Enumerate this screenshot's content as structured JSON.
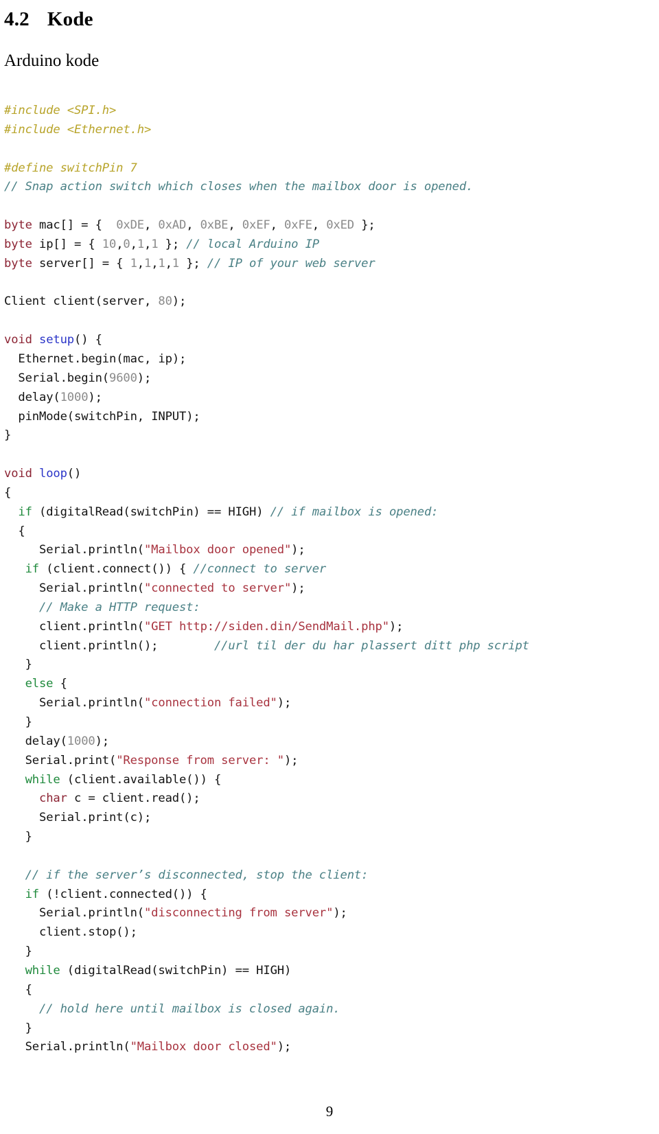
{
  "document": {
    "section_number": "4.2",
    "section_title": "Kode",
    "subtitle": "Arduino kode",
    "page_number": "9"
  },
  "colors": {
    "preprocessor": "#b8a42a",
    "comment": "#4a8085",
    "keyword": "#8c2434",
    "function": "#2b35c8",
    "control": "#1f8a3c",
    "string": "#a8333f",
    "number": "#8a8a8a",
    "plain": "#121212",
    "background": "#ffffff"
  },
  "code": {
    "language": "Arduino C++",
    "lines": [
      {
        "id": "l1",
        "text": "#include <SPI.h>"
      },
      {
        "id": "l2",
        "text": "#include <Ethernet.h>"
      },
      {
        "id": "l3",
        "text": ""
      },
      {
        "id": "l4",
        "text": "#define switchPin 7"
      },
      {
        "id": "l5",
        "text": "// Snap action switch which closes when the mailbox door is opened."
      },
      {
        "id": "l6",
        "text": ""
      },
      {
        "id": "l7",
        "text": "byte mac[] = {  0xDE, 0xAD, 0xBE, 0xEF, 0xFE, 0xED };"
      },
      {
        "id": "l8",
        "text": "byte ip[] = { 10,0,1,1 }; // local Arduino IP"
      },
      {
        "id": "l9",
        "text": "byte server[] = { 1,1,1,1 }; // IP of your web server"
      },
      {
        "id": "l10",
        "text": ""
      },
      {
        "id": "l11",
        "text": "Client client(server, 80);"
      },
      {
        "id": "l12",
        "text": ""
      },
      {
        "id": "l13",
        "text": "void setup() {"
      },
      {
        "id": "l14",
        "text": "  Ethernet.begin(mac, ip);"
      },
      {
        "id": "l15",
        "text": "  Serial.begin(9600);"
      },
      {
        "id": "l16",
        "text": "  delay(1000);"
      },
      {
        "id": "l17",
        "text": "  pinMode(switchPin, INPUT);"
      },
      {
        "id": "l18",
        "text": "}"
      },
      {
        "id": "l19",
        "text": ""
      },
      {
        "id": "l20",
        "text": "void loop()"
      },
      {
        "id": "l21",
        "text": "{"
      },
      {
        "id": "l22",
        "text": "  if (digitalRead(switchPin) == HIGH) // if mailbox is opened:"
      },
      {
        "id": "l23",
        "text": "  {"
      },
      {
        "id": "l24",
        "text": "     Serial.println(\"Mailbox door opened\");"
      },
      {
        "id": "l25",
        "text": "   if (client.connect()) { //connect to server"
      },
      {
        "id": "l26",
        "text": "     Serial.println(\"connected to server\");"
      },
      {
        "id": "l27",
        "text": "     // Make a HTTP request:"
      },
      {
        "id": "l28",
        "text": "     client.println(\"GET http://siden.din/SendMail.php\");"
      },
      {
        "id": "l29",
        "text": "     client.println();        //url til der du har plassert ditt php script"
      },
      {
        "id": "l30",
        "text": "   }"
      },
      {
        "id": "l31",
        "text": "   else {"
      },
      {
        "id": "l32",
        "text": "     Serial.println(\"connection failed\");"
      },
      {
        "id": "l33",
        "text": "   }"
      },
      {
        "id": "l34",
        "text": "   delay(1000);"
      },
      {
        "id": "l35",
        "text": "   Serial.print(\"Response from server: \");"
      },
      {
        "id": "l36",
        "text": "   while (client.available()) {"
      },
      {
        "id": "l37",
        "text": "     char c = client.read();"
      },
      {
        "id": "l38",
        "text": "     Serial.print(c);"
      },
      {
        "id": "l39",
        "text": "   }"
      },
      {
        "id": "l40",
        "text": ""
      },
      {
        "id": "l41",
        "text": "   // if the server’s disconnected, stop the client:"
      },
      {
        "id": "l42",
        "text": "   if (!client.connected()) {"
      },
      {
        "id": "l43",
        "text": "     Serial.println(\"disconnecting from server\");"
      },
      {
        "id": "l44",
        "text": "     client.stop();"
      },
      {
        "id": "l45",
        "text": "   }"
      },
      {
        "id": "l46",
        "text": "   while (digitalRead(switchPin) == HIGH)"
      },
      {
        "id": "l47",
        "text": "   {"
      },
      {
        "id": "l48",
        "text": "     // hold here until mailbox is closed again."
      },
      {
        "id": "l49",
        "text": "   }"
      },
      {
        "id": "l50",
        "text": "   Serial.println(\"Mailbox door closed\");"
      }
    ]
  }
}
